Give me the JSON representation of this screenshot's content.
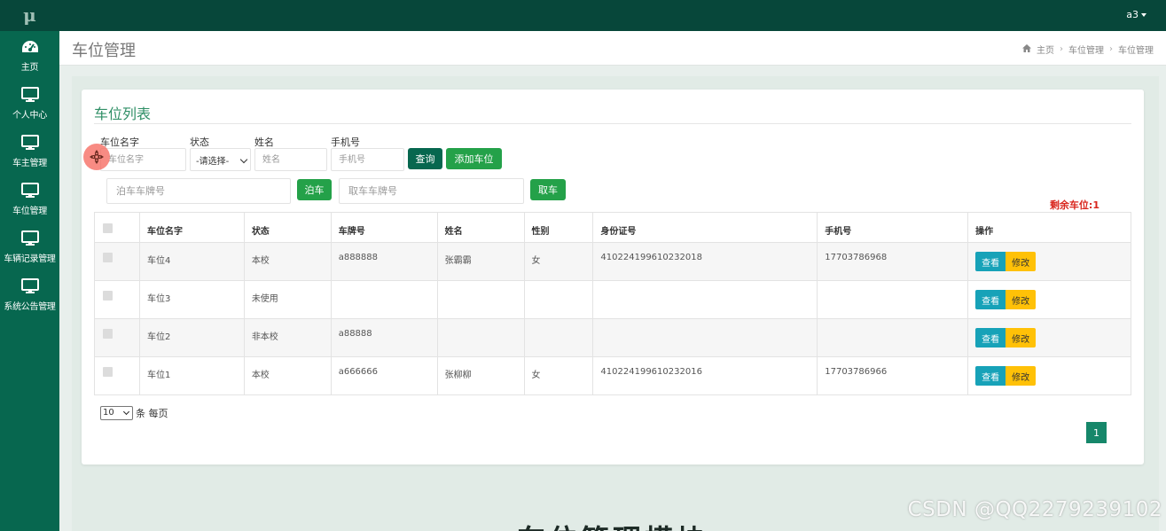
{
  "topbar": {
    "logo": "μ",
    "user": "a3"
  },
  "sidebar": {
    "items": [
      {
        "label": "主页",
        "icon": "dashboard-icon"
      },
      {
        "label": "个人中心",
        "icon": "monitor-icon"
      },
      {
        "label": "车主管理",
        "icon": "monitor-icon"
      },
      {
        "label": "车位管理",
        "icon": "monitor-icon"
      },
      {
        "label": "车辆记录管理",
        "icon": "monitor-icon"
      },
      {
        "label": "系统公告管理",
        "icon": "monitor-icon"
      }
    ]
  },
  "header": {
    "title": "车位管理",
    "breadcrumb": [
      "主页",
      "车位管理",
      "车位管理"
    ]
  },
  "card": {
    "title": "车位列表"
  },
  "filters": {
    "name_label": "车位名字",
    "name_placeholder": "车位名字",
    "status_label": "状态",
    "status_value": "-请选择-",
    "person_label": "姓名",
    "person_placeholder": "姓名",
    "phone_label": "手机号",
    "phone_placeholder": "手机号",
    "query_button": "查询",
    "add_button": "添加车位"
  },
  "parking": {
    "park_placeholder": "泊车车牌号",
    "park_button": "泊车",
    "pick_placeholder": "取车车牌号",
    "pick_button": "取车"
  },
  "remaining": "剩余车位:1",
  "table": {
    "headers": [
      "车位名字",
      "状态",
      "车牌号",
      "姓名",
      "性别",
      "身份证号",
      "手机号",
      "操作"
    ],
    "view_label": "查看",
    "edit_label": "修改",
    "rows": [
      {
        "name": "车位4",
        "status": "本校",
        "plate": "a888888",
        "person": "张霸霸",
        "gender": "女",
        "idcard": "410224199610232018",
        "phone": "17703786968"
      },
      {
        "name": "车位3",
        "status": "未使用",
        "plate": "",
        "person": "",
        "gender": "",
        "idcard": "",
        "phone": ""
      },
      {
        "name": "车位2",
        "status": "非本校",
        "plate": "a88888",
        "person": "",
        "gender": "",
        "idcard": "",
        "phone": ""
      },
      {
        "name": "车位1",
        "status": "本校",
        "plate": "a666666",
        "person": "张柳柳",
        "gender": "女",
        "idcard": "410224199610232016",
        "phone": "17703786966"
      }
    ]
  },
  "pagination": {
    "page_size": "10",
    "per_page_label": "条 每页",
    "current_page": "1"
  },
  "watermark": "CSDN @QQ2279239102",
  "bottom_text": "车位管理模块"
}
